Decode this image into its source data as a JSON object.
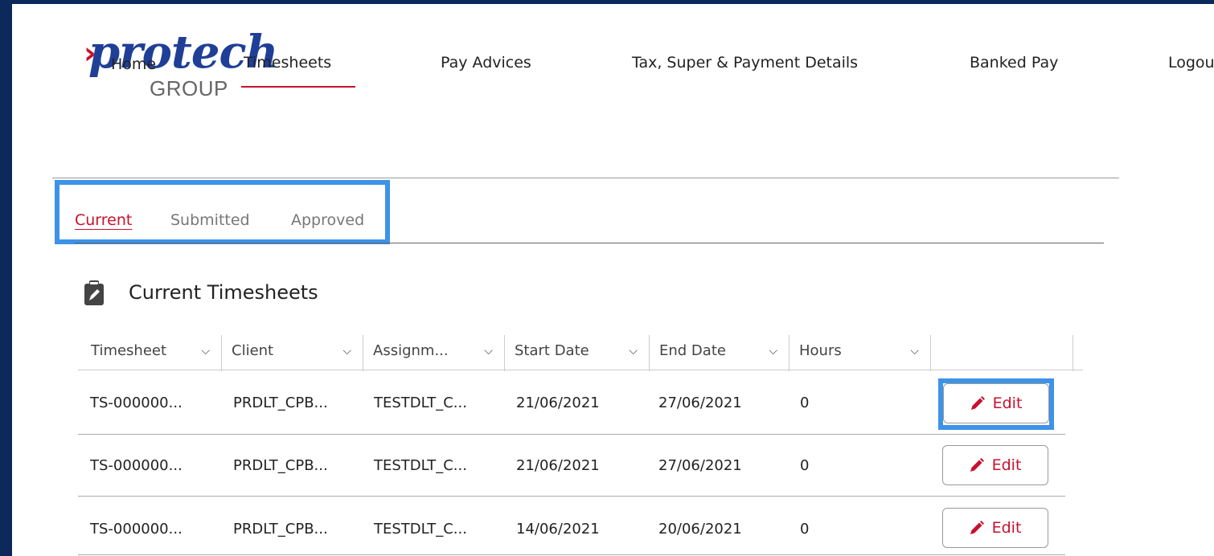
{
  "header": {
    "logo": {
      "word": "protech",
      "group": "GROUP"
    },
    "nav": [
      {
        "label": "Home"
      },
      {
        "label": "Timesheets"
      },
      {
        "label": "Pay Advices"
      },
      {
        "label": "Tax, Super & Payment Details"
      },
      {
        "label": "Banked Pay"
      },
      {
        "label": "Logou"
      }
    ]
  },
  "tabs": [
    {
      "label": "Current",
      "active": true
    },
    {
      "label": "Submitted"
    },
    {
      "label": "Approved"
    }
  ],
  "section": {
    "title": "Current Timesheets",
    "icon": "clipboard-pencil-icon"
  },
  "table": {
    "columns": [
      "Timesheet",
      "Client",
      "Assignm...",
      "Start Date",
      "End Date",
      "Hours"
    ],
    "rows": [
      [
        "TS-000000...",
        "PRDLT_CPB...",
        "TESTDLT_C...",
        "21/06/2021",
        "27/06/2021",
        "0"
      ],
      [
        "TS-000000...",
        "PRDLT_CPB...",
        "TESTDLT_C...",
        "21/06/2021",
        "27/06/2021",
        "0"
      ],
      [
        "TS-000000...",
        "PRDLT_CPB...",
        "TESTDLT_C...",
        "14/06/2021",
        "20/06/2021",
        "0"
      ]
    ],
    "action_label": "Edit"
  },
  "colors": {
    "accent": "#c8102e",
    "brand_blue": "#1f3f97",
    "highlight": "#3d93e8",
    "outer_bg": "#0b2a5b"
  }
}
